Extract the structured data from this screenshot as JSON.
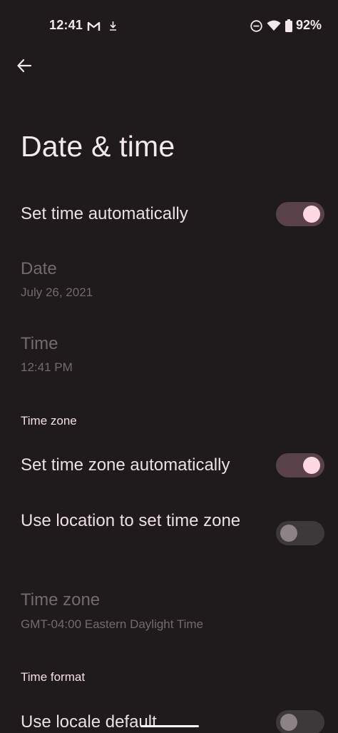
{
  "status_bar": {
    "time": "12:41",
    "battery": "92%",
    "icons": [
      "gmail-icon",
      "download-icon",
      "do-not-disturb-icon",
      "wifi-icon",
      "battery-icon"
    ]
  },
  "nav": {
    "back_icon": "arrow-left-icon"
  },
  "page": {
    "title": "Date & time"
  },
  "settings": {
    "set_time_auto": {
      "label": "Set time automatically",
      "enabled": true
    },
    "date": {
      "label": "Date",
      "value": "July 26, 2021"
    },
    "time": {
      "label": "Time",
      "value": "12:41 PM"
    },
    "time_zone_header": "Time zone",
    "set_zone_auto": {
      "label": "Set time zone automatically",
      "enabled": true
    },
    "use_location": {
      "label": "Use location to set time zone",
      "enabled": false
    },
    "time_zone": {
      "label": "Time zone",
      "value": "GMT-04:00 Eastern Daylight Time"
    },
    "time_format_header": "Time format",
    "use_locale_default": {
      "label": "Use locale default",
      "enabled": false
    }
  },
  "colors": {
    "background": "#1f1b1c",
    "switch_on_track": "#5a424a",
    "switch_on_thumb": "#ffd8e4",
    "switch_off_track": "#3d3839",
    "switch_off_thumb": "#8b8385",
    "accent_header": "#f4dfe4"
  }
}
